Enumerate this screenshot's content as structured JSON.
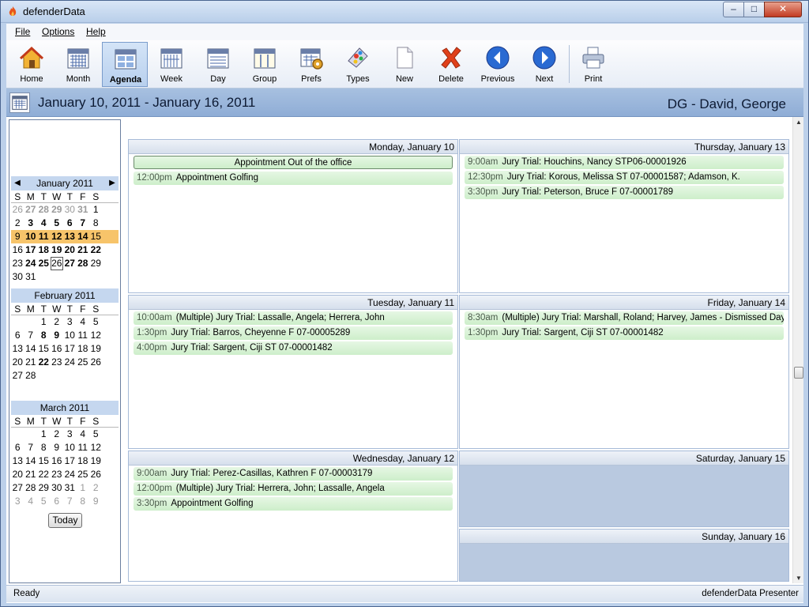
{
  "window": {
    "title": "defenderData"
  },
  "menu": {
    "file": "File",
    "options": "Options",
    "help": "Help"
  },
  "toolbar": {
    "home": "Home",
    "month": "Month",
    "agenda": "Agenda",
    "week": "Week",
    "day": "Day",
    "group": "Group",
    "prefs": "Prefs",
    "types": "Types",
    "new": "New",
    "delete": "Delete",
    "previous": "Previous",
    "next": "Next",
    "print": "Print"
  },
  "header": {
    "date_range": "January 10, 2011 - January 16, 2011",
    "person": "DG - David, George"
  },
  "navigator": {
    "dow": [
      "S",
      "M",
      "T",
      "W",
      "T",
      "F",
      "S"
    ],
    "months": [
      {
        "name": "January 2011",
        "weeks": [
          [
            {
              "d": "26",
              "g": 1
            },
            {
              "d": "27",
              "g": 1,
              "b": 1
            },
            {
              "d": "28",
              "g": 1,
              "b": 1
            },
            {
              "d": "29",
              "g": 1,
              "b": 1
            },
            {
              "d": "30",
              "g": 1
            },
            {
              "d": "31",
              "g": 1,
              "b": 1
            },
            {
              "d": "1"
            }
          ],
          [
            {
              "d": "2"
            },
            {
              "d": "3",
              "b": 1
            },
            {
              "d": "4",
              "b": 1
            },
            {
              "d": "5",
              "b": 1
            },
            {
              "d": "6",
              "b": 1
            },
            {
              "d": "7",
              "b": 1
            },
            {
              "d": "8"
            }
          ],
          [
            {
              "d": "9"
            },
            {
              "d": "10",
              "b": 1
            },
            {
              "d": "11",
              "b": 1
            },
            {
              "d": "12",
              "b": 1
            },
            {
              "d": "13",
              "b": 1
            },
            {
              "d": "14",
              "b": 1
            },
            {
              "d": "15"
            }
          ],
          [
            {
              "d": "16"
            },
            {
              "d": "17",
              "b": 1
            },
            {
              "d": "18",
              "b": 1
            },
            {
              "d": "19",
              "b": 1
            },
            {
              "d": "20",
              "b": 1
            },
            {
              "d": "21",
              "b": 1
            },
            {
              "d": "22",
              "b": 1
            }
          ],
          [
            {
              "d": "23"
            },
            {
              "d": "24",
              "b": 1
            },
            {
              "d": "25",
              "b": 1
            },
            {
              "d": "26",
              "t": 1
            },
            {
              "d": "27",
              "b": 1
            },
            {
              "d": "28",
              "b": 1
            },
            {
              "d": "29"
            }
          ],
          [
            {
              "d": "30"
            },
            {
              "d": "31"
            }
          ]
        ],
        "selected_week": 2
      },
      {
        "name": "February 2011",
        "weeks": [
          [
            {
              "d": ""
            },
            {
              "d": ""
            },
            {
              "d": "1"
            },
            {
              "d": "2"
            },
            {
              "d": "3"
            },
            {
              "d": "4"
            },
            {
              "d": "5"
            }
          ],
          [
            {
              "d": "6"
            },
            {
              "d": "7"
            },
            {
              "d": "8",
              "b": 1
            },
            {
              "d": "9",
              "b": 1
            },
            {
              "d": "10"
            },
            {
              "d": "11"
            },
            {
              "d": "12"
            }
          ],
          [
            {
              "d": "13"
            },
            {
              "d": "14"
            },
            {
              "d": "15"
            },
            {
              "d": "16"
            },
            {
              "d": "17"
            },
            {
              "d": "18"
            },
            {
              "d": "19"
            }
          ],
          [
            {
              "d": "20"
            },
            {
              "d": "21"
            },
            {
              "d": "22",
              "b": 1
            },
            {
              "d": "23"
            },
            {
              "d": "24"
            },
            {
              "d": "25"
            },
            {
              "d": "26"
            }
          ],
          [
            {
              "d": "27"
            },
            {
              "d": "28"
            }
          ]
        ]
      },
      {
        "name": "March 2011",
        "weeks": [
          [
            {
              "d": ""
            },
            {
              "d": ""
            },
            {
              "d": "1"
            },
            {
              "d": "2"
            },
            {
              "d": "3"
            },
            {
              "d": "4"
            },
            {
              "d": "5"
            }
          ],
          [
            {
              "d": "6"
            },
            {
              "d": "7"
            },
            {
              "d": "8"
            },
            {
              "d": "9"
            },
            {
              "d": "10"
            },
            {
              "d": "11"
            },
            {
              "d": "12"
            }
          ],
          [
            {
              "d": "13"
            },
            {
              "d": "14"
            },
            {
              "d": "15"
            },
            {
              "d": "16"
            },
            {
              "d": "17"
            },
            {
              "d": "18"
            },
            {
              "d": "19"
            }
          ],
          [
            {
              "d": "20"
            },
            {
              "d": "21"
            },
            {
              "d": "22"
            },
            {
              "d": "23"
            },
            {
              "d": "24"
            },
            {
              "d": "25"
            },
            {
              "d": "26"
            }
          ],
          [
            {
              "d": "27"
            },
            {
              "d": "28"
            },
            {
              "d": "29"
            },
            {
              "d": "30"
            },
            {
              "d": "31"
            },
            {
              "d": "1",
              "g": 1
            },
            {
              "d": "2",
              "g": 1
            }
          ],
          [
            {
              "d": "3",
              "g": 1
            },
            {
              "d": "4",
              "g": 1
            },
            {
              "d": "5",
              "g": 1
            },
            {
              "d": "6",
              "g": 1
            },
            {
              "d": "7",
              "g": 1
            },
            {
              "d": "8",
              "g": 1
            },
            {
              "d": "9",
              "g": 1
            }
          ]
        ]
      }
    ],
    "today_label": "Today"
  },
  "days": {
    "mon": {
      "label": "Monday, January 10",
      "allday": "Appointment Out of the office",
      "appts": [
        {
          "time": "12:00pm",
          "text": "Appointment Golfing"
        }
      ]
    },
    "tue": {
      "label": "Tuesday, January 11",
      "appts": [
        {
          "time": "10:00am",
          "text": "(Multiple) Jury Trial: Lassalle, Angela; Herrera, John"
        },
        {
          "time": "1:30pm",
          "text": "Jury Trial: Barros, Cheyenne F  07-00005289"
        },
        {
          "time": "4:00pm",
          "text": "Jury Trial: Sargent, Ciji ST 07-00001482"
        }
      ]
    },
    "wed": {
      "label": "Wednesday, January 12",
      "appts": [
        {
          "time": "9:00am",
          "text": "Jury Trial: Perez-Casillas, Kathren F  07-00003179"
        },
        {
          "time": "12:00pm",
          "text": "(Multiple) Jury Trial: Herrera, John; Lassalle, Angela"
        },
        {
          "time": "3:30pm",
          "text": "Appointment Golfing"
        }
      ]
    },
    "thu": {
      "label": "Thursday, January 13",
      "appts": [
        {
          "time": "9:00am",
          "text": "Jury Trial: Houchins, Nancy STP06-00001926"
        },
        {
          "time": "12:30pm",
          "text": "Jury Trial: Korous, Melissa ST 07-00001587; Adamson, K."
        },
        {
          "time": "3:30pm",
          "text": "Jury Trial: Peterson, Bruce F  07-00001789"
        }
      ]
    },
    "fri": {
      "label": "Friday, January 14",
      "appts": [
        {
          "time": "8:30am",
          "text": "(Multiple) Jury Trial: Marshall, Roland; Harvey, James - Dismissed Day Of,"
        },
        {
          "time": "1:30pm",
          "text": "Jury Trial: Sargent, Ciji ST 07-00001482"
        }
      ]
    },
    "sat": {
      "label": "Saturday, January 15"
    },
    "sun": {
      "label": "Sunday, January 16"
    }
  },
  "status": {
    "left": "Ready",
    "right": "defenderData Presenter"
  }
}
